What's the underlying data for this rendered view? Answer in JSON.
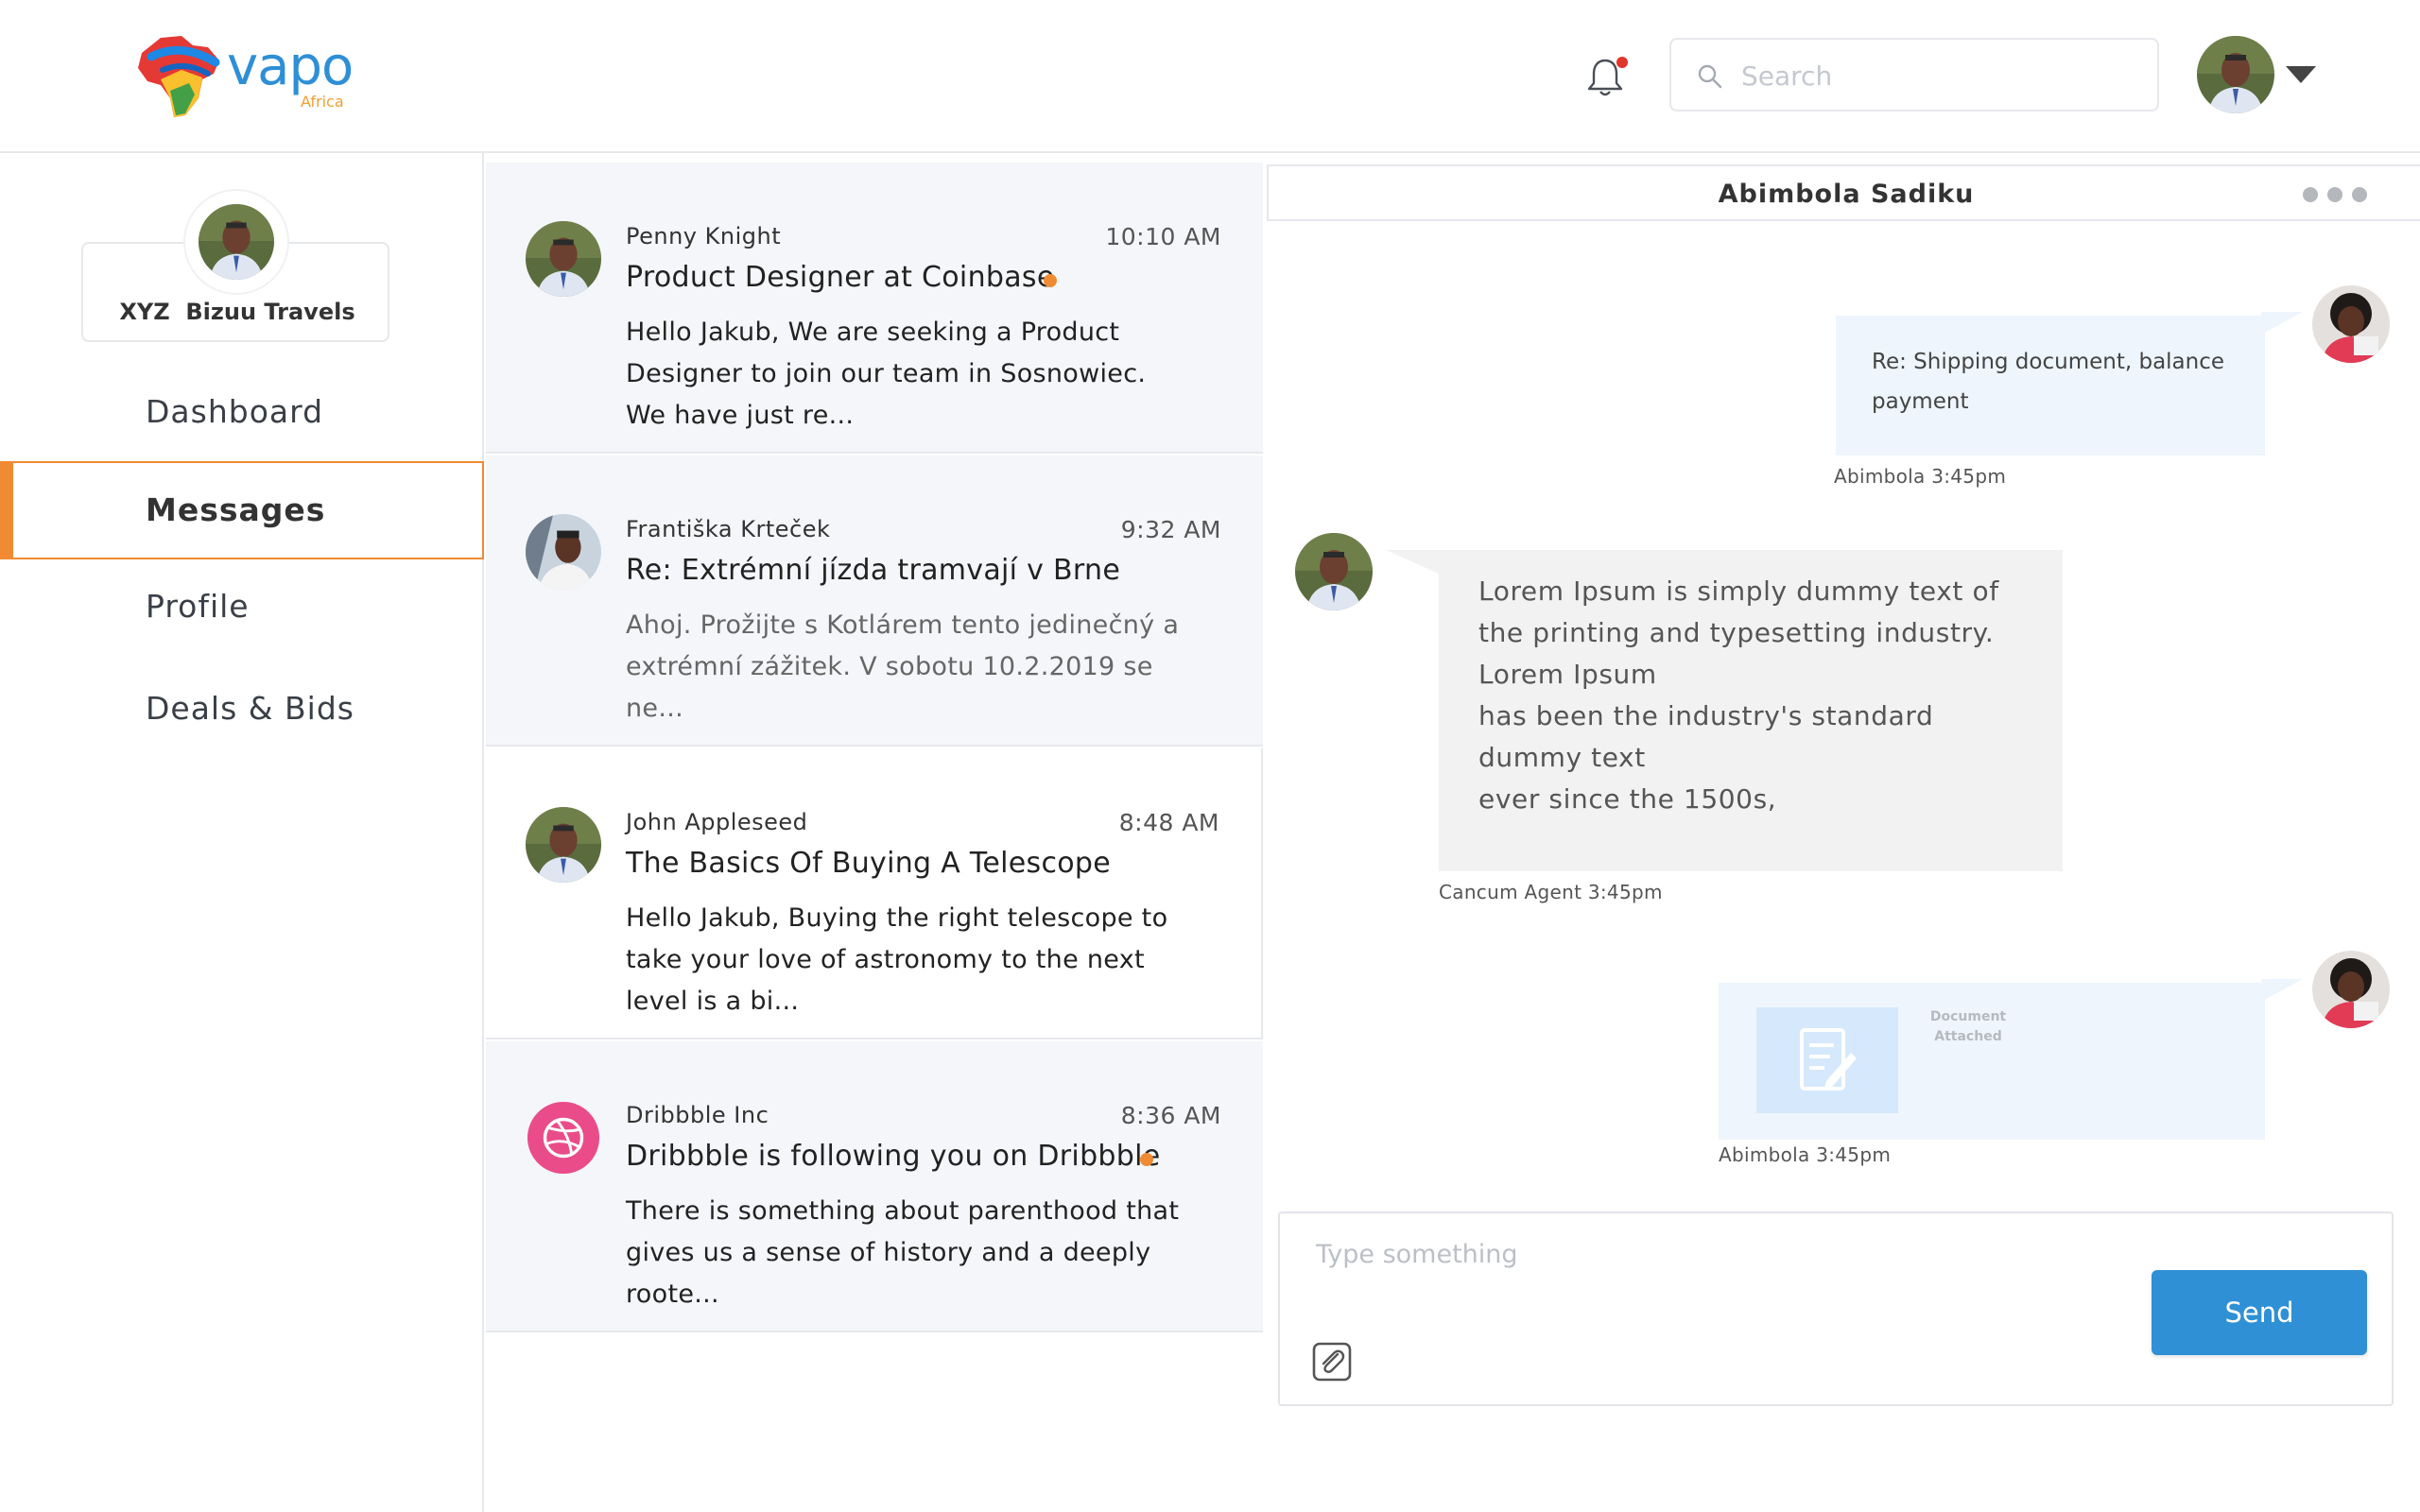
{
  "brand": {
    "name": "vapo",
    "sub": "Africa"
  },
  "header": {
    "search": {
      "placeholder": "Search"
    },
    "notifications": {
      "icon": "bell-icon",
      "has_unread": true
    },
    "user_menu": {
      "icon": "chevron-down-icon"
    }
  },
  "sidebar": {
    "company_name": "XYZ  Bizuu Travels",
    "items": [
      {
        "label": "Dashboard",
        "active": false
      },
      {
        "label": "Messages",
        "active": true
      },
      {
        "label": "Profile",
        "active": false
      },
      {
        "label": "Deals & Bids",
        "active": false
      }
    ]
  },
  "messages": [
    {
      "sender": "Penny Knight",
      "time": "10:10 AM",
      "subject": "Product Designer at Coinbase",
      "unread": true,
      "preview": "Hello Jakub, We are seeking a Product Designer to join our team in Sosnowiec. We have just re..."
    },
    {
      "sender": "Františka Krteček",
      "time": "9:32 AM",
      "subject": "Re: Extrémní jízda tramvají v Brne",
      "unread": false,
      "preview": "Ahoj. Prožijte s Kotlárem tento jedinečný a extrémní zážitek. V sobotu 10.2.2019 se ne..."
    },
    {
      "sender": "John Appleseed",
      "time": "8:48 AM",
      "subject": "The Basics Of Buying A Telescope",
      "unread": false,
      "preview": "Hello Jakub, Buying the right telescope to take your love of astronomy to the next level is a bi..."
    },
    {
      "sender": "Dribbble Inc",
      "time": "8:36 AM",
      "subject": "Dribbble is following you on Dribbble",
      "unread": true,
      "preview": "There is something about parenthood that gives us a sense of history and a deeply roote..."
    }
  ],
  "chat": {
    "title": "Abimbola Sadiku",
    "more_icon": "more-horizontal-icon",
    "conversation": [
      {
        "direction": "out",
        "text": "Re: Shipping document, balance payment",
        "stamp": "Abimbola 3:45pm"
      },
      {
        "direction": "in",
        "text": "Lorem Ipsum is simply dummy text of the printing and typesetting industry. Lorem Ipsum\nhas been the industry's standard dummy text\never since the 1500s,",
        "stamp": "Cancum Agent 3:45pm"
      },
      {
        "direction": "out",
        "attachment_label": "Document Attached",
        "attachment_icon": "document-icon",
        "stamp": "Abimbola 3:45pm"
      }
    ],
    "composer": {
      "placeholder": "Type something",
      "send_label": "Send",
      "attach_icon": "paperclip-icon"
    }
  },
  "colors": {
    "accent": "#f08b34",
    "primary": "#2f90d6",
    "dribbble": "#ea4c89"
  }
}
